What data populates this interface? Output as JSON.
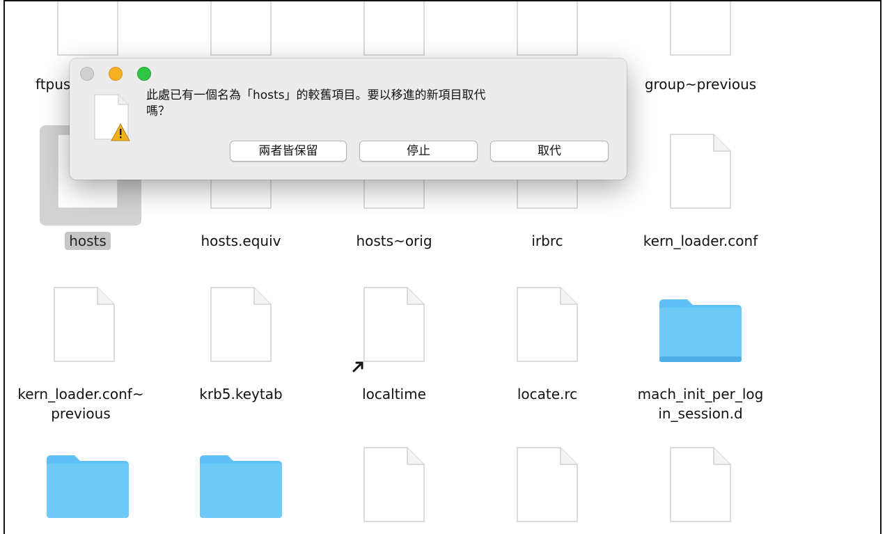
{
  "files": {
    "row0": [
      {
        "name": "ftpusers",
        "type": "doc"
      },
      {
        "name": "",
        "type": "doc"
      },
      {
        "name": "",
        "type": "doc"
      },
      {
        "name": "",
        "type": "doc"
      },
      {
        "name": "group~previous",
        "type": "doc"
      }
    ],
    "row1": [
      {
        "name": "hosts",
        "type": "doc",
        "selected": true
      },
      {
        "name": "hosts.equiv",
        "type": "doc"
      },
      {
        "name": "hosts~orig",
        "type": "doc"
      },
      {
        "name": "irbrc",
        "type": "doc"
      },
      {
        "name": "kern_loader.conf",
        "type": "doc"
      }
    ],
    "row2": [
      {
        "name": "kern_loader.conf~\nprevious",
        "type": "doc"
      },
      {
        "name": "krb5.keytab",
        "type": "doc"
      },
      {
        "name": "localtime",
        "type": "doc-alias"
      },
      {
        "name": "locate.rc",
        "type": "doc"
      },
      {
        "name": "mach_init_per_log\nin_session.d",
        "type": "folder"
      }
    ],
    "row3": [
      {
        "name": "",
        "type": "folder"
      },
      {
        "name": "",
        "type": "folder"
      },
      {
        "name": "",
        "type": "doc"
      },
      {
        "name": "",
        "type": "doc"
      },
      {
        "name": "",
        "type": "doc"
      }
    ],
    "row0_partial_label": "ftpus"
  },
  "dialog": {
    "message_line1": "此處已有一個名為「hosts」的較舊項目。要以移進的新項目取代",
    "message_line2": "嗎？",
    "buttons": {
      "keep_both": "兩者皆保留",
      "stop": "停止",
      "replace": "取代"
    },
    "icon": "warning-document-icon"
  },
  "colors": {
    "folder": "#5ec0f5",
    "selection": "#c6c6c6",
    "dialog_bg": "#ececec",
    "close": "#d0d0d0",
    "minimize": "#f5b023",
    "zoom": "#2fc544"
  }
}
